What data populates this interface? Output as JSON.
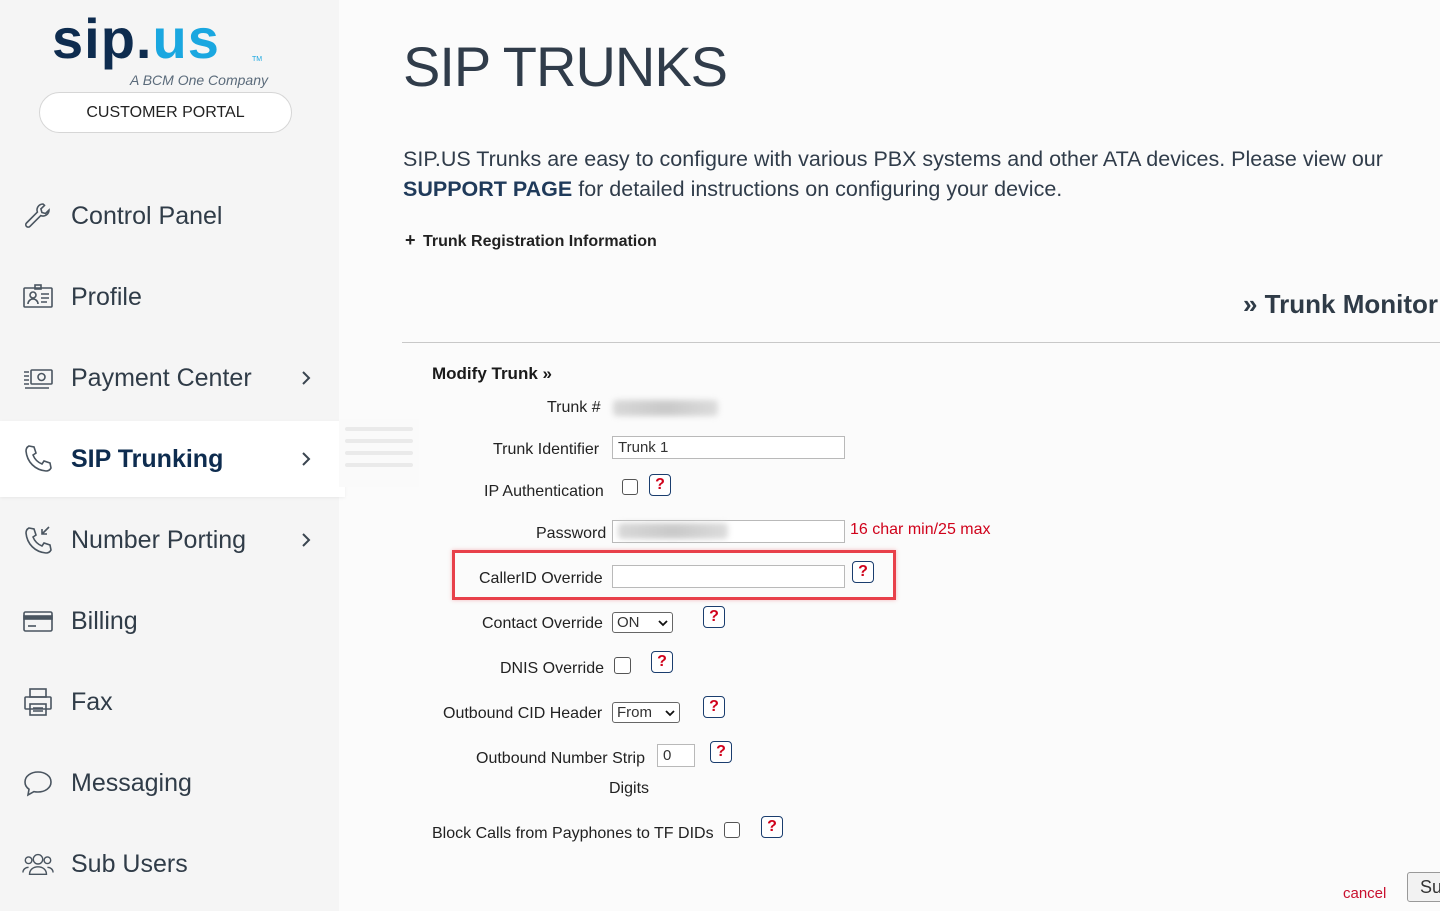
{
  "brand": {
    "logo_sip": "sip",
    "logo_dot": ".",
    "logo_us": "us",
    "tagline": "A BCM One Company",
    "tm": "TM",
    "primary_color": "#0e2c4f",
    "accent_color": "#1aa7e0"
  },
  "sidebar": {
    "portal_button": "CUSTOMER PORTAL",
    "items": [
      {
        "label": "Control Panel",
        "icon": "wrench-icon",
        "has_chevron": false
      },
      {
        "label": "Profile",
        "icon": "id-card-icon",
        "has_chevron": false
      },
      {
        "label": "Payment Center",
        "icon": "cash-icon",
        "has_chevron": true
      },
      {
        "label": "SIP Trunking",
        "icon": "phone-icon",
        "has_chevron": true,
        "active": true
      },
      {
        "label": "Number Porting",
        "icon": "phone-incoming-icon",
        "has_chevron": true
      },
      {
        "label": "Billing",
        "icon": "credit-card-icon",
        "has_chevron": false
      },
      {
        "label": "Fax",
        "icon": "printer-icon",
        "has_chevron": false
      },
      {
        "label": "Messaging",
        "icon": "chat-bubble-icon",
        "has_chevron": false
      },
      {
        "label": "Sub Users",
        "icon": "users-icon",
        "has_chevron": false
      }
    ]
  },
  "main": {
    "title": "SIP TRUNKS",
    "intro_text_1": "SIP.US Trunks are easy to configure with various PBX systems and other ATA devices. Please view our ",
    "intro_link": "SUPPORT PAGE",
    "intro_text_2": " for detailed instructions on configuring your device.",
    "trunk_registration_label": "Trunk Registration Information",
    "trunk_monitor_label": "» Trunk Monitor",
    "modify_title": "Modify Trunk »"
  },
  "form": {
    "trunk_number_label": "Trunk #",
    "trunk_identifier_label": "Trunk Identifier",
    "trunk_identifier_value": "Trunk 1",
    "ip_auth_label": "IP Authentication",
    "ip_auth_checked": false,
    "password_label": "Password",
    "password_hint": "16 char min/25 max",
    "callerid_label": "CallerID Override",
    "callerid_value": "",
    "contact_override_label": "Contact Override",
    "contact_override_value": "ON",
    "dnis_override_label": "DNIS Override",
    "dnis_override_checked": false,
    "outbound_cid_label": "Outbound CID Header",
    "outbound_cid_value": "From",
    "strip_label": "Outbound Number Strip",
    "strip_label_2": "Digits",
    "strip_value": "0",
    "block_payphones_label": "Block Calls from Payphones to TF DIDs",
    "block_payphones_checked": false,
    "help_glyph": "?",
    "cancel_label": "cancel",
    "submit_label": "Submit"
  },
  "colors": {
    "highlight": "#e8404a",
    "error_text": "#d0021b",
    "help_border": "#1a3d6e"
  }
}
